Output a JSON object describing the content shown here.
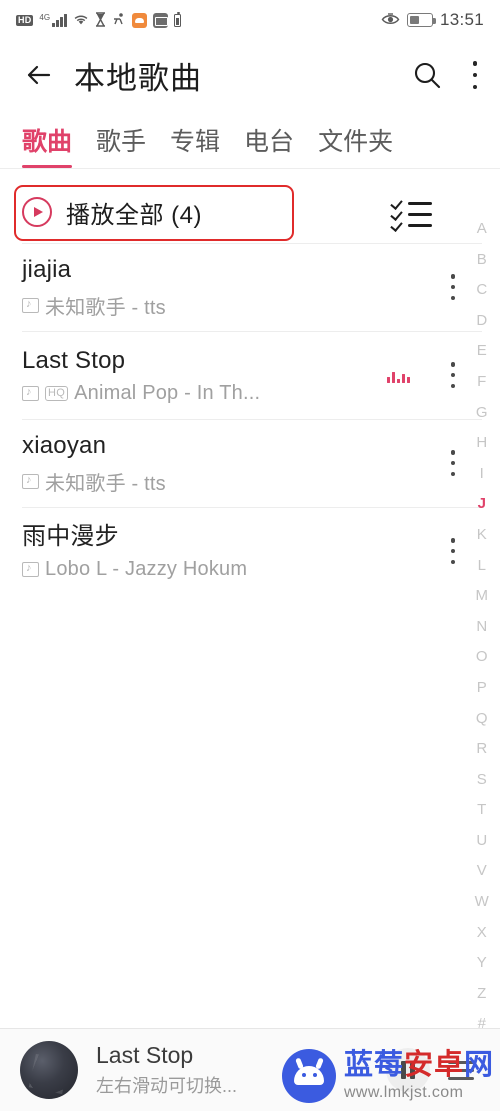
{
  "status_bar": {
    "hd_badge": "HD",
    "network_gen": "4G",
    "icons": [
      "hd-badge",
      "signal-bars",
      "wifi-icon",
      "hourglass-icon",
      "accessibility-icon",
      "app-orange-icon",
      "app-gray-icon",
      "battery-small-icon"
    ],
    "right_icons": [
      "eye-care-icon",
      "battery-icon"
    ],
    "time": "13:51"
  },
  "appbar": {
    "back_label": "back",
    "title": "本地歌曲",
    "search_label": "search",
    "menu_label": "more"
  },
  "tabs": [
    {
      "label": "歌曲",
      "active": true
    },
    {
      "label": "歌手",
      "active": false
    },
    {
      "label": "专辑",
      "active": false
    },
    {
      "label": "电台",
      "active": false
    },
    {
      "label": "文件夹",
      "active": false
    }
  ],
  "play_all": {
    "label": "播放全部 (4)",
    "count": 4,
    "multiselect_label": "multi-select",
    "highlight_color": "#e02b2b"
  },
  "songs": [
    {
      "title": "jiajia",
      "subtitle": "未知歌手 - tts",
      "badges": [
        "mv"
      ],
      "playing": false
    },
    {
      "title": "Last Stop",
      "subtitle": "Animal Pop - In Th...",
      "badges": [
        "mv",
        "HQ"
      ],
      "playing": true
    },
    {
      "title": "xiaoyan",
      "subtitle": "未知歌手 - tts",
      "badges": [
        "mv"
      ],
      "playing": false
    },
    {
      "title": "雨中漫步",
      "subtitle": "Lobo L - Jazzy Hokum",
      "badges": [
        "mv"
      ],
      "playing": false
    }
  ],
  "alpha_index": {
    "letters": [
      "A",
      "B",
      "C",
      "D",
      "E",
      "F",
      "G",
      "H",
      "I",
      "J",
      "K",
      "L",
      "M",
      "N",
      "O",
      "P",
      "Q",
      "R",
      "S",
      "T",
      "U",
      "V",
      "W",
      "X",
      "Y",
      "Z",
      "#"
    ],
    "active": "J",
    "active_color": "#e0426a"
  },
  "player": {
    "title": "Last Stop",
    "subtitle": "左右滑动可切换...",
    "cover_label": "album-art",
    "pause_label": "pause",
    "playlist_label": "playlist"
  },
  "watermark": {
    "cn_blue": "蓝莓",
    "cn_red": "安卓",
    "cn_blue2": "网",
    "url": "www.lmkjst.com"
  },
  "colors": {
    "accent": "#e0426a",
    "annotation": "#e02b2b",
    "text": "#222222",
    "muted": "#a0a0a0"
  }
}
